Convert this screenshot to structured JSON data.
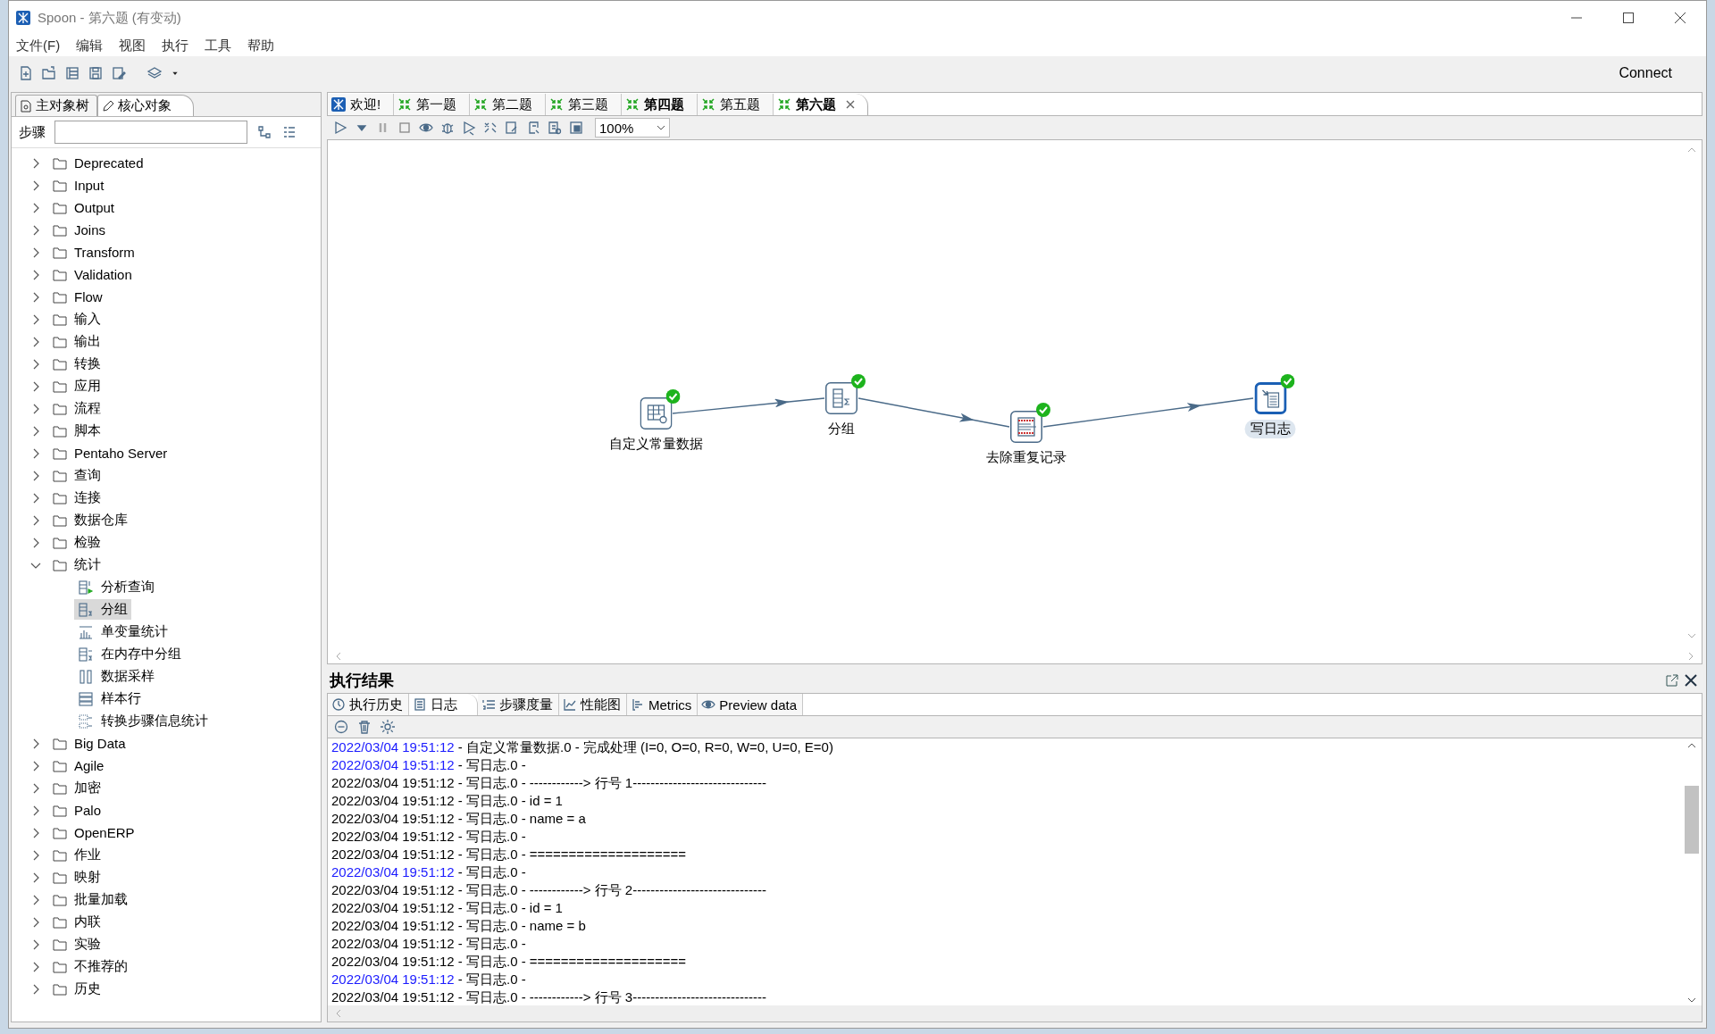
{
  "window": {
    "title": "Spoon - 第六题 (有变动)"
  },
  "menu": [
    {
      "label": "文件(F)"
    },
    {
      "label": "编辑"
    },
    {
      "label": "视图"
    },
    {
      "label": "执行"
    },
    {
      "label": "工具"
    },
    {
      "label": "帮助"
    }
  ],
  "toolbar": {
    "connect": "Connect"
  },
  "left_tabs": [
    {
      "label": "主对象树",
      "kind": "tree",
      "selected": false
    },
    {
      "label": "核心对象",
      "kind": "pencil",
      "selected": true
    }
  ],
  "steps_search": {
    "label": "步骤"
  },
  "tree": [
    {
      "label": "Deprecated",
      "expanded": false
    },
    {
      "label": "Input",
      "expanded": false
    },
    {
      "label": "Output",
      "expanded": false
    },
    {
      "label": "Joins",
      "expanded": false
    },
    {
      "label": "Transform",
      "expanded": false
    },
    {
      "label": "Validation",
      "expanded": false
    },
    {
      "label": "Flow",
      "expanded": false
    },
    {
      "label": "输入",
      "expanded": false
    },
    {
      "label": "输出",
      "expanded": false
    },
    {
      "label": "转换",
      "expanded": false
    },
    {
      "label": "应用",
      "expanded": false
    },
    {
      "label": "流程",
      "expanded": false
    },
    {
      "label": "脚本",
      "expanded": false
    },
    {
      "label": "Pentaho Server",
      "expanded": false
    },
    {
      "label": "查询",
      "expanded": false
    },
    {
      "label": "连接",
      "expanded": false
    },
    {
      "label": "数据仓库",
      "expanded": false
    },
    {
      "label": "检验",
      "expanded": false
    },
    {
      "label": "统计",
      "expanded": true,
      "children": [
        {
          "label": "分析查询",
          "kind": "analytic",
          "selected": false
        },
        {
          "label": "分组",
          "kind": "groupby",
          "selected": true
        },
        {
          "label": "单变量统计",
          "kind": "bars",
          "selected": false
        },
        {
          "label": "在内存中分组",
          "kind": "memgroup",
          "selected": false
        },
        {
          "label": "数据采样",
          "kind": "sample",
          "selected": false
        },
        {
          "label": "样本行",
          "kind": "rows",
          "selected": false
        },
        {
          "label": "转换步骤信息统计",
          "kind": "stepinfo",
          "selected": false
        }
      ]
    },
    {
      "label": "Big Data",
      "expanded": false
    },
    {
      "label": "Agile",
      "expanded": false
    },
    {
      "label": "加密",
      "expanded": false
    },
    {
      "label": "Palo",
      "expanded": false
    },
    {
      "label": "OpenERP",
      "expanded": false
    },
    {
      "label": "作业",
      "expanded": false
    },
    {
      "label": "映射",
      "expanded": false
    },
    {
      "label": "批量加载",
      "expanded": false
    },
    {
      "label": "内联",
      "expanded": false
    },
    {
      "label": "实验",
      "expanded": false
    },
    {
      "label": "不推荐的",
      "expanded": false
    },
    {
      "label": "历史",
      "expanded": false
    }
  ],
  "editor_tabs": [
    {
      "label": "欢迎!",
      "kind": "welcome",
      "modified": false,
      "selected": false
    },
    {
      "label": "第一题",
      "kind": "transformation",
      "modified": false,
      "selected": false
    },
    {
      "label": "第二题",
      "kind": "transformation",
      "modified": false,
      "selected": false
    },
    {
      "label": "第三题",
      "kind": "transformation",
      "modified": false,
      "selected": false
    },
    {
      "label": "第四题",
      "kind": "transformation",
      "modified": true,
      "selected": false
    },
    {
      "label": "第五题",
      "kind": "transformation",
      "modified": false,
      "selected": false
    },
    {
      "label": "第六题",
      "kind": "transformation",
      "modified": true,
      "selected": true
    }
  ],
  "zoom": {
    "value": "100%"
  },
  "canvas": {
    "steps": [
      {
        "label": "自定义常量数据",
        "kind": "constant",
        "selected": false
      },
      {
        "label": "分组",
        "kind": "groupby",
        "selected": false
      },
      {
        "label": "去除重复记录",
        "kind": "unique",
        "selected": false
      },
      {
        "label": "写日志",
        "kind": "log",
        "selected": true
      }
    ]
  },
  "results": {
    "title": "执行结果",
    "tabs": [
      {
        "label": "执行历史",
        "kind": "history",
        "selected": false
      },
      {
        "label": "日志",
        "kind": "log",
        "selected": true
      },
      {
        "label": "步骤度量",
        "kind": "metrics-list",
        "selected": false
      },
      {
        "label": "性能图",
        "kind": "chart",
        "selected": false
      },
      {
        "label": "Metrics",
        "kind": "metrics",
        "selected": false
      },
      {
        "label": "Preview data",
        "kind": "eye",
        "selected": false
      }
    ],
    "log": [
      {
        "time": "2022/03/04 19:51:12",
        "highlight": true,
        "message": " - 自定义常量数据.0 - 完成处理 (I=0, O=0, R=0, W=0, U=0, E=0)"
      },
      {
        "time": "2022/03/04 19:51:12",
        "highlight": true,
        "message": " - 写日志.0 -"
      },
      {
        "time": "2022/03/04 19:51:12",
        "highlight": false,
        "message": " - 写日志.0 - ------------> 行号 1------------------------------"
      },
      {
        "time": "2022/03/04 19:51:12",
        "highlight": false,
        "message": " - 写日志.0 - id = 1"
      },
      {
        "time": "2022/03/04 19:51:12",
        "highlight": false,
        "message": " - 写日志.0 - name = a"
      },
      {
        "time": "2022/03/04 19:51:12",
        "highlight": false,
        "message": " - 写日志.0 -"
      },
      {
        "time": "2022/03/04 19:51:12",
        "highlight": false,
        "message": " - 写日志.0 - ===================="
      },
      {
        "time": "2022/03/04 19:51:12",
        "highlight": true,
        "message": " - 写日志.0 -"
      },
      {
        "time": "2022/03/04 19:51:12",
        "highlight": false,
        "message": " - 写日志.0 - ------------> 行号 2------------------------------"
      },
      {
        "time": "2022/03/04 19:51:12",
        "highlight": false,
        "message": " - 写日志.0 - id = 1"
      },
      {
        "time": "2022/03/04 19:51:12",
        "highlight": false,
        "message": " - 写日志.0 - name = b"
      },
      {
        "time": "2022/03/04 19:51:12",
        "highlight": false,
        "message": " - 写日志.0 -"
      },
      {
        "time": "2022/03/04 19:51:12",
        "highlight": false,
        "message": " - 写日志.0 - ===================="
      },
      {
        "time": "2022/03/04 19:51:12",
        "highlight": true,
        "message": " - 写日志.0 -"
      },
      {
        "time": "2022/03/04 19:51:12",
        "highlight": false,
        "message": " - 写日志.0 - ------------> 行号 3------------------------------"
      }
    ]
  }
}
